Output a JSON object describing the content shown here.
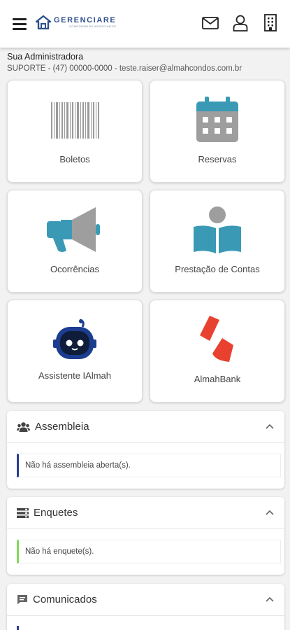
{
  "header": {
    "logo_name": "GERENCIARE",
    "logo_tagline": "CONDOMÍNIOS ASSOCIADOS",
    "icons": [
      "menu-icon",
      "mail-icon",
      "user-icon",
      "building-icon"
    ]
  },
  "admin": {
    "title": "Sua Administradora",
    "info": "SUPORTE - (47) 00000-0000 - teste.raiser@almahcondos.com.br"
  },
  "tiles": [
    {
      "label": "Boletos",
      "icon": "barcode-icon"
    },
    {
      "label": "Reservas",
      "icon": "calendar-icon"
    },
    {
      "label": "Ocorrências",
      "icon": "megaphone-icon"
    },
    {
      "label": "Prestação de Contas",
      "icon": "reading-person-icon"
    },
    {
      "label": "Assistente IAlmah",
      "icon": "robot-icon"
    },
    {
      "label": "AlmahBank",
      "icon": "almahbank-logo-icon"
    }
  ],
  "panels": [
    {
      "title": "Assembleia",
      "icon": "users-icon",
      "notice": "Não há assembleia aberta(s).",
      "accent": "#2c3e91"
    },
    {
      "title": "Enquetes",
      "icon": "list-icon",
      "notice": "Não há enquete(s).",
      "accent": "#7ed957"
    },
    {
      "title": "Comunicados",
      "icon": "chat-icon",
      "notice": "",
      "accent": "#2c3e91"
    }
  ],
  "colors": {
    "brand": "#2e4f8a",
    "teal": "#3a9ab5",
    "red": "#e8412f",
    "robot": "#1b3d8f"
  }
}
